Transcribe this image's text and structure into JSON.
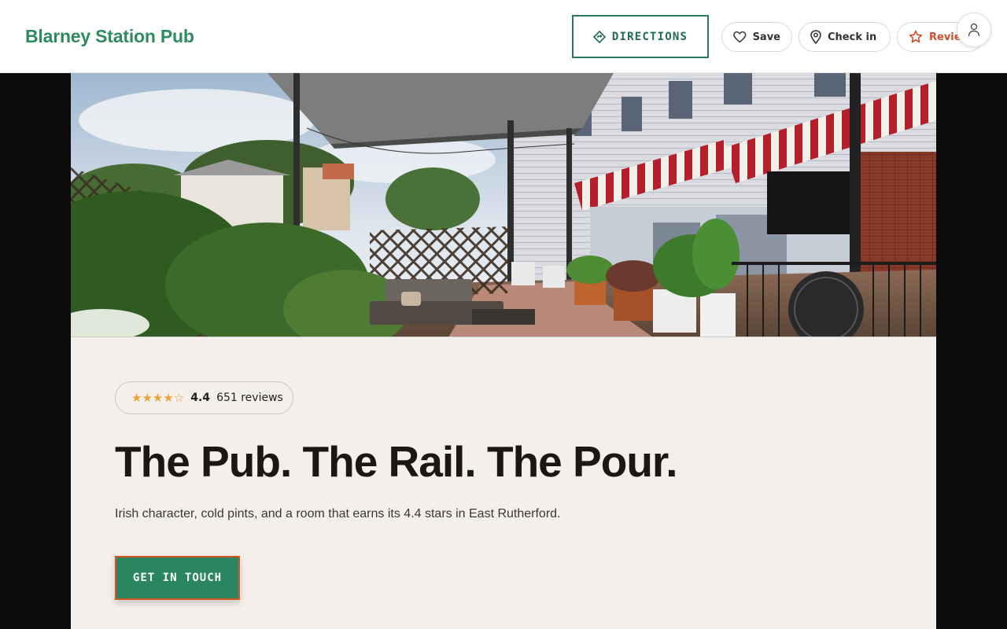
{
  "header": {
    "brand": "Blarney Station Pub",
    "directions_label": "DIRECTIONS",
    "save_label": "Save",
    "checkin_label": "Check in",
    "review_label": "Review"
  },
  "hero": {
    "alt": "Outdoor patio of Blarney Station Pub with lounge seating, planters and red awnings"
  },
  "main": {
    "stars": "★★★★☆",
    "rating_value": "4.4",
    "reviews_text": "651 reviews",
    "headline": "The Pub. The Rail. The Pour.",
    "subtitle": "Irish character, cold pints, and a room that earns its 4.4 stars in East Rutherford.",
    "cta_label": "GET IN TOUCH"
  },
  "colors": {
    "brand_green": "#2f8a62",
    "accent_orange": "#d2541f",
    "panel_bg": "#f4efea",
    "star": "#e6a33a"
  }
}
